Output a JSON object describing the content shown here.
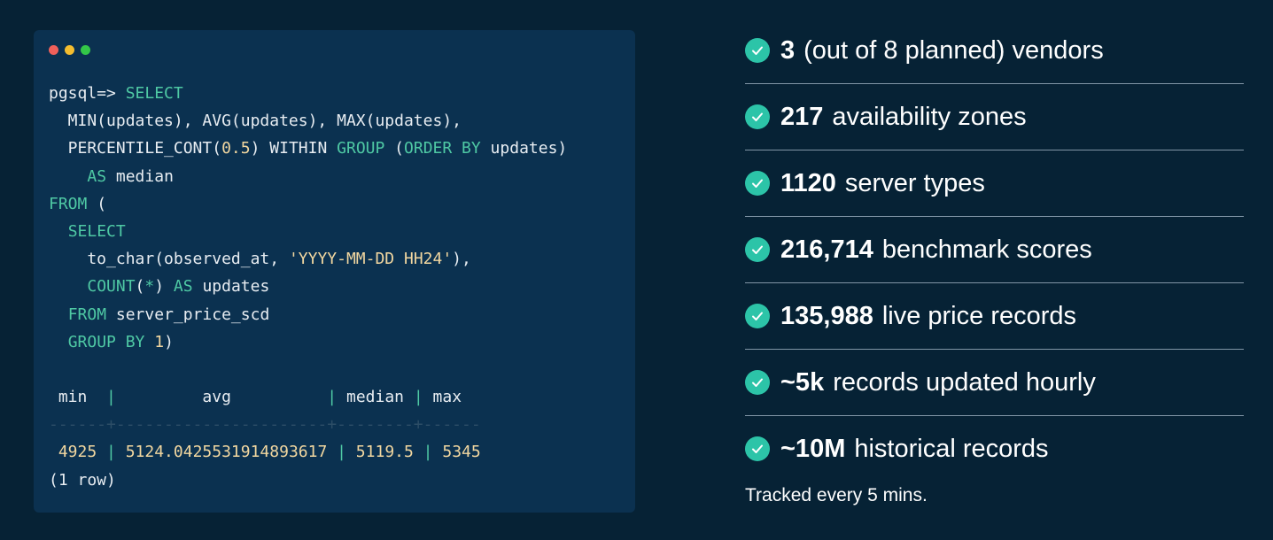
{
  "terminal": {
    "window_buttons": [
      "close",
      "minimize",
      "maximize"
    ],
    "query_lines": [
      [
        {
          "t": "pgsql=> ",
          "c": ""
        },
        {
          "t": "SELECT",
          "c": "kw"
        }
      ],
      [
        {
          "t": "  MIN(updates), AVG(updates), MAX(updates),",
          "c": ""
        }
      ],
      [
        {
          "t": "  PERCENTILE_CONT(",
          "c": ""
        },
        {
          "t": "0.5",
          "c": "num"
        },
        {
          "t": ") WITHIN ",
          "c": ""
        },
        {
          "t": "GROUP",
          "c": "kw"
        },
        {
          "t": " (",
          "c": ""
        },
        {
          "t": "ORDER BY",
          "c": "kw"
        },
        {
          "t": " updates)",
          "c": ""
        }
      ],
      [
        {
          "t": "    ",
          "c": ""
        },
        {
          "t": "AS",
          "c": "kw"
        },
        {
          "t": " median",
          "c": ""
        }
      ],
      [
        {
          "t": "FROM",
          "c": "kw"
        },
        {
          "t": " (",
          "c": ""
        }
      ],
      [
        {
          "t": "  ",
          "c": ""
        },
        {
          "t": "SELECT",
          "c": "kw"
        }
      ],
      [
        {
          "t": "    to_char(observed_at, ",
          "c": ""
        },
        {
          "t": "'YYYY-MM-DD HH24'",
          "c": "str"
        },
        {
          "t": "),",
          "c": ""
        }
      ],
      [
        {
          "t": "    ",
          "c": ""
        },
        {
          "t": "COUNT",
          "c": "kw"
        },
        {
          "t": "(",
          "c": ""
        },
        {
          "t": "*",
          "c": "kw"
        },
        {
          "t": ") ",
          "c": ""
        },
        {
          "t": "AS",
          "c": "kw"
        },
        {
          "t": " updates",
          "c": ""
        }
      ],
      [
        {
          "t": "  ",
          "c": ""
        },
        {
          "t": "FROM",
          "c": "kw"
        },
        {
          "t": " server_price_scd",
          "c": ""
        }
      ],
      [
        {
          "t": "  ",
          "c": ""
        },
        {
          "t": "GROUP BY",
          "c": "kw"
        },
        {
          "t": " ",
          "c": ""
        },
        {
          "t": "1",
          "c": "num"
        },
        {
          "t": ")",
          "c": ""
        }
      ],
      [
        {
          "t": "",
          "c": ""
        }
      ],
      [
        {
          "t": " min  ",
          "c": ""
        },
        {
          "t": "|",
          "c": "kw"
        },
        {
          "t": "         avg          ",
          "c": ""
        },
        {
          "t": "|",
          "c": "kw"
        },
        {
          "t": " median ",
          "c": ""
        },
        {
          "t": "|",
          "c": "kw"
        },
        {
          "t": " max",
          "c": ""
        }
      ],
      [
        {
          "t": "------+----------------------+--------+------",
          "c": "sep"
        }
      ],
      [
        {
          "t": " 4925 ",
          "c": "str"
        },
        {
          "t": "|",
          "c": "kw"
        },
        {
          "t": " 5124.0425531914893617 ",
          "c": "str"
        },
        {
          "t": "|",
          "c": "kw"
        },
        {
          "t": " 5119.5 ",
          "c": "str"
        },
        {
          "t": "|",
          "c": "kw"
        },
        {
          "t": " 5345",
          "c": "str"
        }
      ],
      [
        {
          "t": "(1 row)",
          "c": ""
        }
      ]
    ]
  },
  "features": [
    {
      "value": "3",
      "text": "(out of 8 planned) vendors"
    },
    {
      "value": "217",
      "text": "availability zones"
    },
    {
      "value": "1120",
      "text": "server types"
    },
    {
      "value": "216,714",
      "text": "benchmark scores"
    },
    {
      "value": "135,988",
      "text": "live price records"
    },
    {
      "value": "~5k",
      "text": "records updated hourly"
    },
    {
      "value": "~10M",
      "text": "historical records"
    }
  ],
  "footnote": "Tracked every 5 mins.",
  "colors": {
    "background": "#062235",
    "terminal": "#0b3150",
    "accent": "#2cc4a8",
    "keyword": "#4fc9a4",
    "literal": "#f2d7a0"
  }
}
